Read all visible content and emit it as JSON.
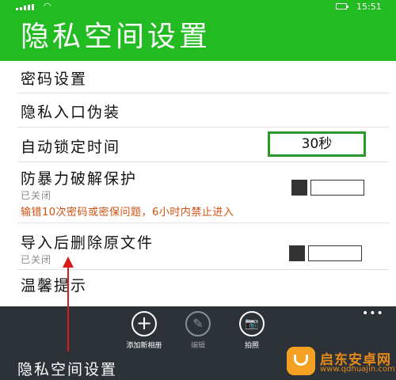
{
  "status_bar": {
    "time": "15:51"
  },
  "header": {
    "title": "隐私空间设置"
  },
  "settings": {
    "password": {
      "label": "密码设置"
    },
    "entry_disguise": {
      "label": "隐私入口伪装"
    },
    "auto_lock": {
      "label": "自动锁定时间",
      "value": "30秒"
    },
    "anti_brute": {
      "label": "防暴力破解保护",
      "state": "已关闭",
      "toggle_on": false,
      "warning": "输错10次密码或密保问题，6小时内禁止进入"
    },
    "delete_after_import": {
      "label": "导入后删除原文件",
      "state": "已关闭",
      "toggle_on": false
    },
    "tips": {
      "label": "温馨提示"
    }
  },
  "app_bar": {
    "buttons": [
      {
        "label": "添加新相册",
        "icon": "plus-icon",
        "enabled": true
      },
      {
        "label": "编辑",
        "icon": "pencil-icon",
        "enabled": false
      },
      {
        "label": "拍照",
        "icon": "camera-icon",
        "enabled": true
      }
    ],
    "more": "•••"
  },
  "caption": "隐私空间设置",
  "watermark": {
    "name": "启东安卓网",
    "url": "www.qdhuajin.com"
  },
  "colors": {
    "accent": "#22bb22",
    "warning": "#d05010",
    "annotation_arrow": "#d81b1b",
    "app_bar": "#2c3238"
  }
}
